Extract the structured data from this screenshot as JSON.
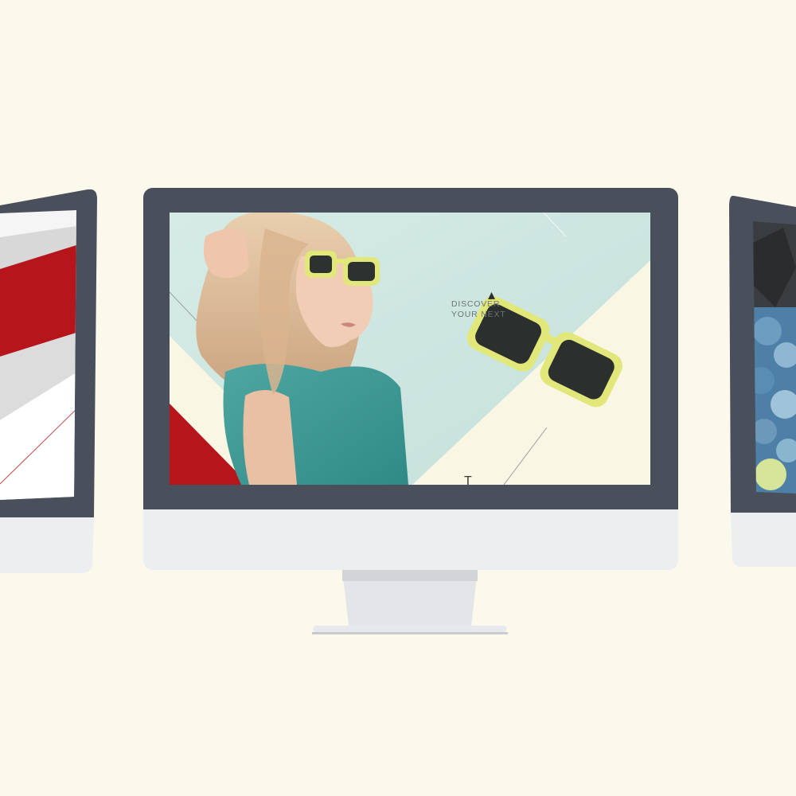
{
  "scene": {
    "background_color": "#fbf9ec"
  },
  "center_monitor": {
    "bezel_color": "#4a4f5c",
    "chin_color": "#edeef0",
    "screen": {
      "headline_line1": "DISCOVER",
      "headline_line2": "YOUR NEXT",
      "accent_red": "#b5151b",
      "panel_cream": "#f9f6e4",
      "backdrop_mint": "#cfe6e1",
      "sunglasses_color": "#e2e77a"
    }
  },
  "left_monitor": {
    "bezel_color": "#4a4f5c",
    "accent_red": "#b5151b"
  },
  "right_monitor": {
    "bezel_color": "#4a4f5c",
    "floral_color": "#4e7fa6"
  }
}
